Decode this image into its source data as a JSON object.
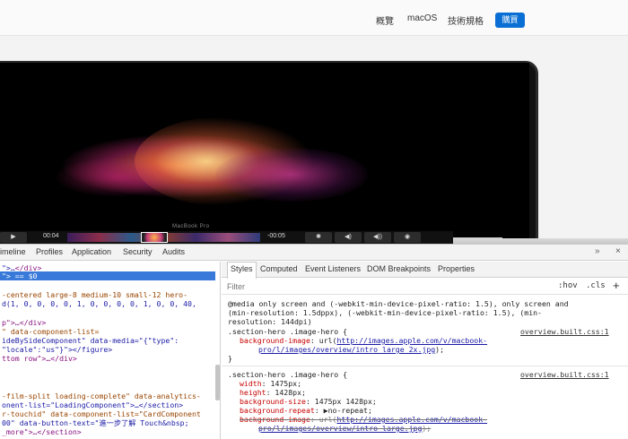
{
  "site_nav": {
    "links": [
      "概覽",
      "macOS",
      "技術規格"
    ],
    "buy_label": "購買",
    "accent": "#0a6fd4"
  },
  "hero": {
    "brand": "MacBook Pro",
    "touchbar": {
      "time_start": "00:04",
      "time_end": "-00:05",
      "buttons": [
        "▶",
        "✱",
        "◀︎)",
        "◀︎))",
        "◉"
      ]
    }
  },
  "devtools": {
    "tabs": [
      "imeline",
      "Profiles",
      "Application",
      "Security",
      "Audits"
    ],
    "more_icon": "»",
    "close_icon": "×",
    "elements": [
      {
        "kind": "html",
        "html": "<span class='tag'>&lt;/div&gt;</span>",
        "prefix": "\">…"
      },
      {
        "kind": "selected",
        "text": "\"> == $0"
      },
      {
        "kind": "blank"
      },
      {
        "kind": "attrline",
        "text": "-centered large-8 medium-10 small-12 hero-"
      },
      {
        "kind": "attrline",
        "text": "d(1, 0, 0, 0, 0, 1, 0, 0, 0, 0, 1, 0, 0, 40,"
      },
      {
        "kind": "blank"
      },
      {
        "kind": "mixed",
        "text": "p\">…</div>"
      },
      {
        "kind": "mixed",
        "text": "\" data-component-list="
      },
      {
        "kind": "mixed",
        "text": "ideBySideComponent\" data-media=\"{\"type\":"
      },
      {
        "kind": "mixed",
        "text": "\"locale\":\"us\"}\"></figure>"
      },
      {
        "kind": "mixed",
        "text": "ttom row\">…</div>"
      },
      {
        "kind": "blank"
      },
      {
        "kind": "blank"
      },
      {
        "kind": "blank"
      },
      {
        "kind": "mixed",
        "text": "-film-split loading-complete\" data-analytics-"
      },
      {
        "kind": "mixed",
        "text": "onent-list=\"LoadingComponent\">…</section>"
      },
      {
        "kind": "mixed",
        "text": "r-touchid\" data-component-list=\"CardComponent"
      },
      {
        "kind": "mixed",
        "text": "00\" data-button-text=\"進一步了解 Touch&nbsp;"
      },
      {
        "kind": "mixed",
        "text": "_more\">…</section>"
      }
    ],
    "styles": {
      "tabs": [
        "Styles",
        "Computed",
        "Event Listeners",
        "DOM Breakpoints",
        "Properties"
      ],
      "filter_placeholder": "Filter",
      "hov": ":hov",
      "cls": ".cls",
      "plus": "+",
      "media_lines": [
        "@media only screen and (-webkit-min-device-pixel-ratio: 1.5), only screen and",
        "(min-resolution: 1.5dppx), (-webkit-min-device-pixel-ratio: 1.5), (min-",
        "resolution: 144dpi)"
      ],
      "rule1": {
        "selector": ".section-hero .image-hero {",
        "source": "overview.built.css:1",
        "props": [
          {
            "name": "background-image",
            "pre": ": url(",
            "link": "http://images.apple.com/v/macbook-",
            "post": ""
          },
          {
            "name": "",
            "pre": "",
            "link": "pro/l/images/overview/intro_large_2x.jpg",
            "post": ");"
          }
        ],
        "close": "}"
      },
      "rule2": {
        "selector": ".section-hero .image-hero {",
        "source": "overview.built.css:1",
        "props": [
          {
            "name": "width",
            "value": ": 1475px;"
          },
          {
            "name": "height",
            "value": ": 1428px;"
          },
          {
            "name": "background-size",
            "value": ": 1475px 1428px;"
          },
          {
            "name": "background-repeat",
            "value": ": ▶no-repeat;"
          }
        ],
        "struck": [
          {
            "name": "background-image",
            "pre": ": url(",
            "link": "http://images.apple.com/v/macbook-"
          },
          {
            "name": "",
            "pre": "",
            "link": "pro/l/images/overview/intro_large.jpg",
            "post": ");"
          }
        ]
      }
    }
  }
}
